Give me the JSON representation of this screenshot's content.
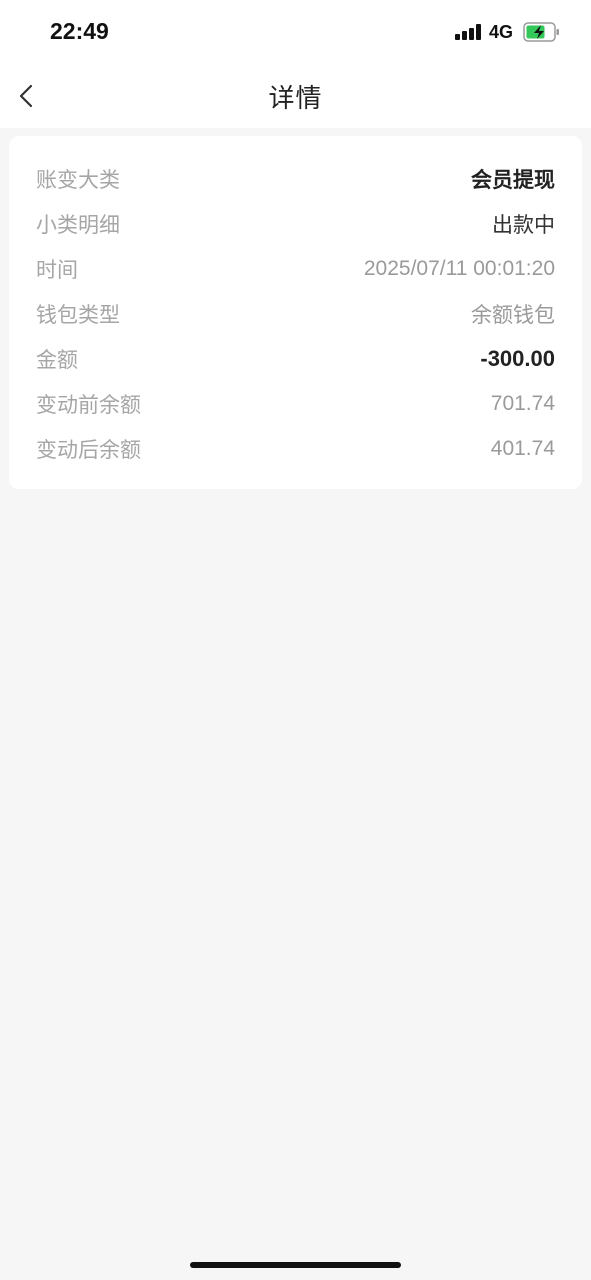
{
  "status_bar": {
    "time": "22:49",
    "network": "4G",
    "icons": [
      "signal-icon",
      "battery-charging-icon"
    ],
    "battery_color": "#34c759"
  },
  "nav": {
    "back_icon": "chevron-left-icon",
    "title": "详情"
  },
  "details": [
    {
      "label": "账变大类",
      "value": "会员提现"
    },
    {
      "label": "小类明细",
      "value": "出款中"
    },
    {
      "label": "时间",
      "value": "2025/07/11 00:01:20"
    },
    {
      "label": "钱包类型",
      "value": "余额钱包"
    },
    {
      "label": "金额",
      "value": "-300.00"
    },
    {
      "label": "变动前余额",
      "value": "701.74"
    },
    {
      "label": "变动后余额",
      "value": "401.74"
    }
  ]
}
